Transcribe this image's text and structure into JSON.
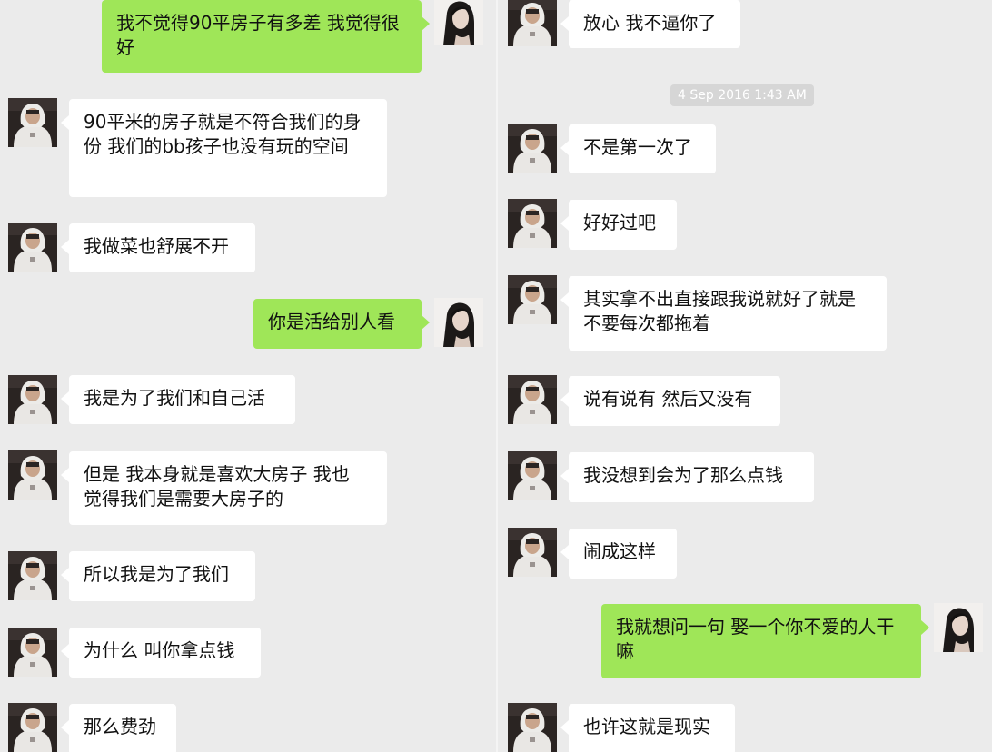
{
  "left_messages": [
    {
      "side": "out",
      "avatar": "female",
      "text": "我不觉得90平房子有多差 我觉得很好"
    },
    {
      "side": "in",
      "avatar": "male",
      "text": "90平米的房子就是不符合我们的身份 我们的bb孩子也没有玩的空间"
    },
    {
      "side": "in",
      "avatar": "male",
      "text": "我做菜也舒展不开"
    },
    {
      "side": "out",
      "avatar": "female",
      "text": "你是活给别人看"
    },
    {
      "side": "in",
      "avatar": "male",
      "text": "我是为了我们和自己活"
    },
    {
      "side": "in",
      "avatar": "male",
      "text": "但是 我本身就是喜欢大房子 我也觉得我们是需要大房子的"
    },
    {
      "side": "in",
      "avatar": "male",
      "text": "所以我是为了我们"
    },
    {
      "side": "in",
      "avatar": "male",
      "text": "为什么 叫你拿点钱"
    },
    {
      "side": "in",
      "avatar": "male",
      "text": "那么费劲"
    }
  ],
  "right_messages": [
    {
      "side": "in",
      "avatar": "male",
      "text": "放心 我不逼你了"
    },
    {
      "side": "in",
      "avatar": "male",
      "text": "不是第一次了"
    },
    {
      "side": "in",
      "avatar": "male",
      "text": "好好过吧"
    },
    {
      "side": "in",
      "avatar": "male",
      "text": "其实拿不出直接跟我说就好了就是不要每次都拖着"
    },
    {
      "side": "in",
      "avatar": "male",
      "text": "说有说有 然后又没有"
    },
    {
      "side": "in",
      "avatar": "male",
      "text": "我没想到会为了那么点钱"
    },
    {
      "side": "in",
      "avatar": "male",
      "text": "闹成这样"
    },
    {
      "side": "out",
      "avatar": "female",
      "text": "我就想问一句 娶一个你不爱的人干嘛"
    },
    {
      "side": "in",
      "avatar": "male",
      "text": "也许这就是现实"
    }
  ],
  "timestamp": "4 Sep 2016 1:43 AM",
  "colors": {
    "background": "#ebebeb",
    "incoming_bubble": "#ffffff",
    "outgoing_bubble": "#9fe658",
    "timestamp_bg": "#d6d6d6"
  }
}
